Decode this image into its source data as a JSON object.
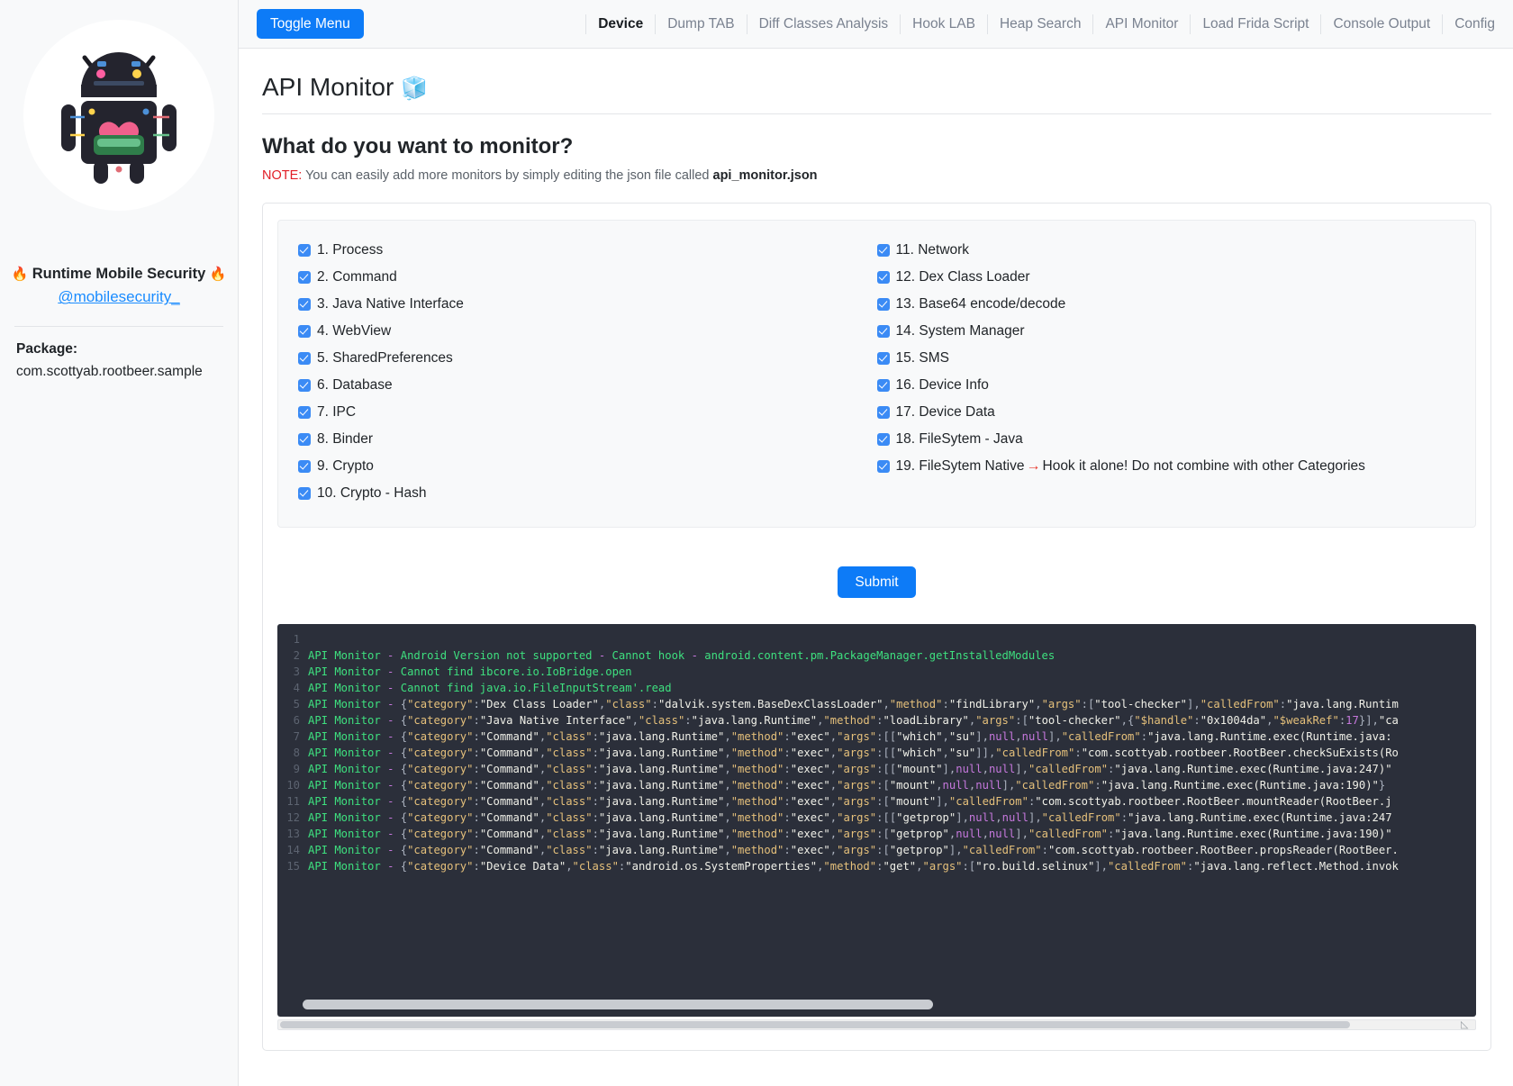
{
  "sidebar": {
    "brand": "Runtime Mobile Security",
    "brand_flame": "🔥",
    "handle": "@mobilesecurity_",
    "package_label": "Package:",
    "package_value": "com.scottyab.rootbeer.sample",
    "avatar_alt": "android-robot-avatar"
  },
  "topbar": {
    "toggle_label": "Toggle Menu",
    "nav": [
      {
        "label": "Device",
        "active": true
      },
      {
        "label": "Dump TAB",
        "active": false
      },
      {
        "label": "Diff Classes Analysis",
        "active": false
      },
      {
        "label": "Hook LAB",
        "active": false
      },
      {
        "label": "Heap Search",
        "active": false
      },
      {
        "label": "API Monitor",
        "active": false
      },
      {
        "label": "Load Frida Script",
        "active": false
      },
      {
        "label": "Console Output",
        "active": false
      },
      {
        "label": "Config",
        "active": false
      }
    ]
  },
  "page": {
    "title": "API Monitor",
    "title_emoji": "🧊",
    "question": "What do you want to monitor?",
    "note_tag": "NOTE:",
    "note_text": " You can easily add more monitors by simply editing the json file called ",
    "note_file": "api_monitor.json",
    "submit_label": "Submit"
  },
  "monitors": {
    "left": [
      {
        "label": "1. Process",
        "checked": true
      },
      {
        "label": "2. Command",
        "checked": true
      },
      {
        "label": "3. Java Native Interface",
        "checked": true
      },
      {
        "label": "4. WebView",
        "checked": true
      },
      {
        "label": "5. SharedPreferences",
        "checked": true
      },
      {
        "label": "6. Database",
        "checked": true
      },
      {
        "label": "7. IPC",
        "checked": true
      },
      {
        "label": "8. Binder",
        "checked": true
      },
      {
        "label": "9. Crypto",
        "checked": true
      },
      {
        "label": "10. Crypto - Hash",
        "checked": true
      }
    ],
    "right": [
      {
        "label": "11. Network",
        "checked": true
      },
      {
        "label": "12. Dex Class Loader",
        "checked": true
      },
      {
        "label": "13. Base64 encode/decode",
        "checked": true
      },
      {
        "label": "14. System Manager",
        "checked": true
      },
      {
        "label": "15. SMS",
        "checked": true
      },
      {
        "label": "16. Device Info",
        "checked": true
      },
      {
        "label": "17. Device Data",
        "checked": true
      },
      {
        "label": "18. FileSytem - Java",
        "checked": true
      },
      {
        "label": "19. FileSytem Native",
        "checked": true,
        "arrow": "→",
        "suffix": "Hook it alone! Do not combine with other Categories"
      }
    ]
  },
  "console": {
    "lines": [
      {
        "n": "1",
        "text": ""
      },
      {
        "n": "2",
        "text": "API Monitor - Android Version not supported - Cannot hook - android.content.pm.PackageManager.getInstalledModules"
      },
      {
        "n": "3",
        "text": "API Monitor - Cannot find ibcore.io.IoBridge.open"
      },
      {
        "n": "4",
        "text": "API Monitor - Cannot find java.io.FileInputStream'.read"
      },
      {
        "n": "5",
        "text": "API Monitor - {\"category\":\"Dex Class Loader\",\"class\":\"dalvik.system.BaseDexClassLoader\",\"method\":\"findLibrary\",\"args\":[\"tool-checker\"],\"calledFrom\":\"java.lang.Runtim"
      },
      {
        "n": "6",
        "text": "API Monitor - {\"category\":\"Java Native Interface\",\"class\":\"java.lang.Runtime\",\"method\":\"loadLibrary\",\"args\":[\"tool-checker\",{\"$handle\":\"0x1004da\",\"$weakRef\":17}],\"ca"
      },
      {
        "n": "7",
        "text": "API Monitor - {\"category\":\"Command\",\"class\":\"java.lang.Runtime\",\"method\":\"exec\",\"args\":[[\"which\",\"su\"],null,null],\"calledFrom\":\"java.lang.Runtime.exec(Runtime.java:"
      },
      {
        "n": "8",
        "text": "API Monitor - {\"category\":\"Command\",\"class\":\"java.lang.Runtime\",\"method\":\"exec\",\"args\":[[\"which\",\"su\"]],\"calledFrom\":\"com.scottyab.rootbeer.RootBeer.checkSuExists(Ro"
      },
      {
        "n": "9",
        "text": "API Monitor - {\"category\":\"Command\",\"class\":\"java.lang.Runtime\",\"method\":\"exec\",\"args\":[[\"mount\"],null,null],\"calledFrom\":\"java.lang.Runtime.exec(Runtime.java:247)\""
      },
      {
        "n": "10",
        "text": "API Monitor - {\"category\":\"Command\",\"class\":\"java.lang.Runtime\",\"method\":\"exec\",\"args\":[\"mount\",null,null],\"calledFrom\":\"java.lang.Runtime.exec(Runtime.java:190)\"}"
      },
      {
        "n": "11",
        "text": "API Monitor - {\"category\":\"Command\",\"class\":\"java.lang.Runtime\",\"method\":\"exec\",\"args\":[\"mount\"],\"calledFrom\":\"com.scottyab.rootbeer.RootBeer.mountReader(RootBeer.j"
      },
      {
        "n": "12",
        "text": "API Monitor - {\"category\":\"Command\",\"class\":\"java.lang.Runtime\",\"method\":\"exec\",\"args\":[[\"getprop\"],null,null],\"calledFrom\":\"java.lang.Runtime.exec(Runtime.java:247"
      },
      {
        "n": "13",
        "text": "API Monitor - {\"category\":\"Command\",\"class\":\"java.lang.Runtime\",\"method\":\"exec\",\"args\":[\"getprop\",null,null],\"calledFrom\":\"java.lang.Runtime.exec(Runtime.java:190)\""
      },
      {
        "n": "14",
        "text": "API Monitor - {\"category\":\"Command\",\"class\":\"java.lang.Runtime\",\"method\":\"exec\",\"args\":[\"getprop\"],\"calledFrom\":\"com.scottyab.rootbeer.RootBeer.propsReader(RootBeer."
      },
      {
        "n": "15",
        "text": "API Monitor - {\"category\":\"Device Data\",\"class\":\"android.os.SystemProperties\",\"method\":\"get\",\"args\":[\"ro.build.selinux\"],\"calledFrom\":\"java.lang.reflect.Method.invok"
      }
    ]
  },
  "colors": {
    "accent": "#0d7bf7",
    "checkbox": "#3b8bf5",
    "console_bg": "#2b2f3a",
    "note_red": "#e11d26",
    "link": "#1a8cff",
    "code_green": "#3ee07f",
    "code_key": "#e5c07b",
    "code_cyan": "#44b6f7",
    "code_magenta": "#c678dd"
  }
}
